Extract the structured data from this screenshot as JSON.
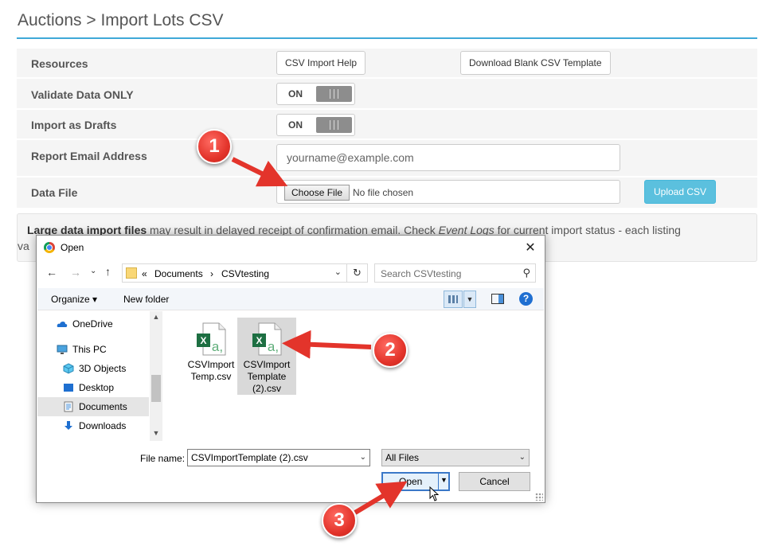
{
  "page": {
    "title": "Auctions > Import Lots CSV"
  },
  "form": {
    "resources_label": "Resources",
    "csv_help_btn": "CSV Import Help",
    "download_template_btn": "Download Blank CSV Template",
    "validate_label": "Validate Data ONLY",
    "validate_toggle": "ON",
    "drafts_label": "Import as Drafts",
    "drafts_toggle": "ON",
    "email_label": "Report Email Address",
    "email_placeholder": "yourname@example.com",
    "datafile_label": "Data File",
    "choose_file_btn": "Choose File",
    "no_file_text": "No file chosen",
    "upload_btn": "Upload CSV"
  },
  "notice": {
    "bold": "Large data import files",
    "text_a": " may result in delayed receipt of confirmation email. Check ",
    "italic": "Event Logs",
    "text_b": " for current import status - each listing",
    "line2": "va"
  },
  "dialog": {
    "title": "Open",
    "close": "✕",
    "breadcrumbs": [
      "«",
      "Documents",
      "›",
      "CSVtesting"
    ],
    "search_placeholder": "Search CSVtesting",
    "organize": "Organize ▾",
    "new_folder": "New folder",
    "help": "?",
    "nav_items": [
      {
        "label": "OneDrive",
        "icon": "onedrive-icon"
      },
      {
        "label": "This PC",
        "icon": "this-pc-icon"
      },
      {
        "label": "3D Objects",
        "icon": "3d-objects-icon"
      },
      {
        "label": "Desktop",
        "icon": "desktop-icon"
      },
      {
        "label": "Documents",
        "icon": "documents-icon",
        "selected": true
      },
      {
        "label": "Downloads",
        "icon": "downloads-icon"
      }
    ],
    "files": [
      {
        "name_l1": "CSVImport",
        "name_l2": "Temp.csv",
        "name_l3": ""
      },
      {
        "name_l1": "CSVImport",
        "name_l2": "Template",
        "name_l3": "(2).csv",
        "selected": true
      }
    ],
    "file_name_label": "File name:",
    "file_name_value": "CSVImportTemplate (2).csv",
    "file_type": "All Files",
    "open_btn": "Open",
    "cancel_btn": "Cancel"
  },
  "annotations": {
    "step1": "1",
    "step2": "2",
    "step3": "3",
    "color": "#e3342b"
  },
  "colors": {
    "accent": "#3fa9d8",
    "upload": "#5bc0de",
    "excel_green": "#1d6f42"
  }
}
